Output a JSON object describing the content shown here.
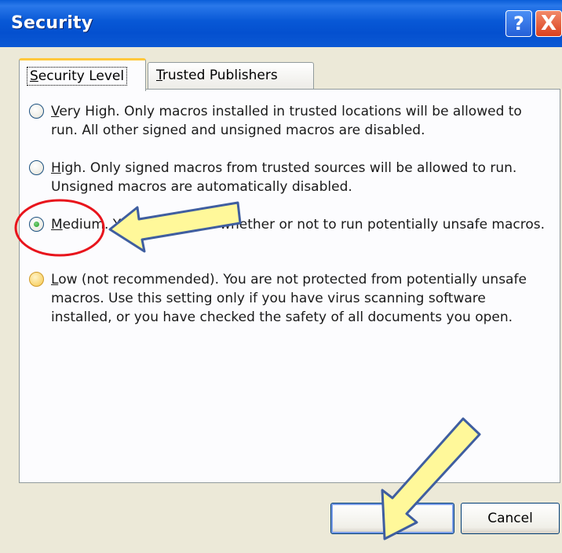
{
  "window": {
    "title": "Security",
    "help_glyph": "?",
    "close_glyph": "X"
  },
  "tabs": [
    {
      "label": "Security Level",
      "mnemonic": "S",
      "rest": "ecurity Level",
      "active": true
    },
    {
      "label": "Trusted Publishers",
      "mnemonic": "T",
      "rest": "rusted Publishers",
      "active": false
    }
  ],
  "options": [
    {
      "mnemonic": "V",
      "rest": "ery High. Only macros installed in trusted locations will be allowed to run. All other signed and unsigned macros are disabled.",
      "selected": false
    },
    {
      "mnemonic": "H",
      "rest": "igh. Only signed macros from trusted sources will be allowed to run. Unsigned macros are automatically disabled.",
      "selected": false
    },
    {
      "mnemonic": "M",
      "rest": "edium. You can choose whether or not to run potentially unsafe macros.",
      "selected": true
    },
    {
      "mnemonic": "L",
      "rest": "ow (not recommended). You are not protected from potentially unsafe macros. Use this setting only if you have virus scanning software installed, or you have checked the safety of all documents you open.",
      "selected": false
    }
  ],
  "buttons": {
    "ok": "OK",
    "cancel": "Cancel"
  },
  "annotations": {
    "arrow_color": "#fff89a",
    "arrow_outline": "#3f5ea0",
    "circle_color": "#e8141c"
  }
}
